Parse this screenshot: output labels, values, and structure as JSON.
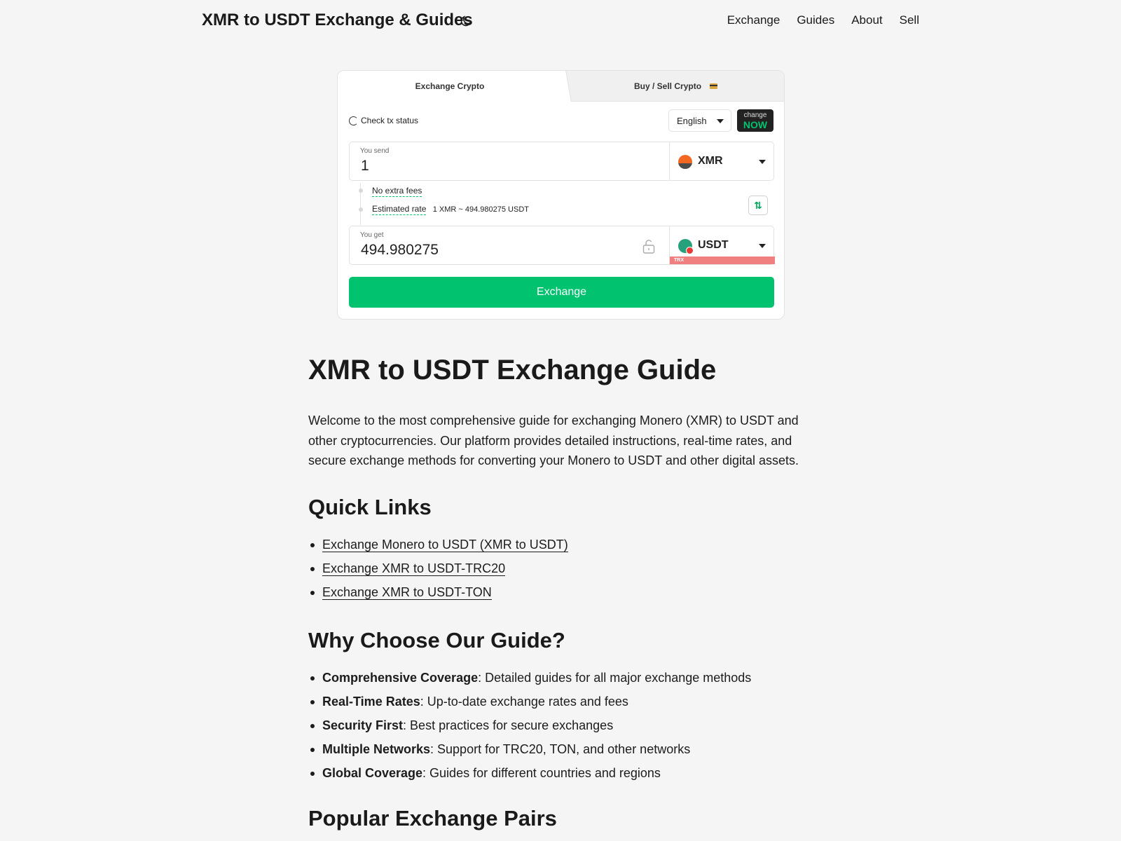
{
  "header": {
    "title": "XMR to USDT Exchange & Guides",
    "nav": [
      "Exchange",
      "Guides",
      "About",
      "Sell"
    ]
  },
  "widget": {
    "tab_exchange": "Exchange Crypto",
    "tab_buy_sell": "Buy / Sell Crypto",
    "check_tx": "Check tx status",
    "language": "English",
    "logo_top": "change",
    "logo_bottom": "NOW",
    "send_label": "You send",
    "send_value": "1",
    "send_currency": "XMR",
    "no_fees": "No extra fees",
    "rate_label": "Estimated rate",
    "rate_value": "1 XMR ~ 494.980275 USDT",
    "get_label": "You get",
    "get_value": "494.980275",
    "get_currency": "USDT",
    "get_network": "TRX",
    "exchange_button": "Exchange",
    "colors": {
      "accent": "#00c26f",
      "network_badge": "#f08080"
    }
  },
  "article": {
    "title": "XMR to USDT Exchange Guide",
    "intro": "Welcome to the most comprehensive guide for exchanging Monero (XMR) to USDT and other cryptocurrencies. Our platform provides detailed instructions, real-time rates, and secure exchange methods for converting your Monero to USDT and other digital assets.",
    "quick_links_heading": "Quick Links",
    "quick_links": [
      "Exchange Monero to USDT (XMR to USDT)",
      "Exchange XMR to USDT-TRC20",
      "Exchange XMR to USDT-TON"
    ],
    "why_heading": "Why Choose Our Guide?",
    "why_items": [
      {
        "bold": "Comprehensive Coverage",
        "text": ": Detailed guides for all major exchange methods"
      },
      {
        "bold": "Real-Time Rates",
        "text": ": Up-to-date exchange rates and fees"
      },
      {
        "bold": "Security First",
        "text": ": Best practices for secure exchanges"
      },
      {
        "bold": "Multiple Networks",
        "text": ": Support for TRC20, TON, and other networks"
      },
      {
        "bold": "Global Coverage",
        "text": ": Guides for different countries and regions"
      }
    ],
    "popular_heading": "Popular Exchange Pairs"
  }
}
